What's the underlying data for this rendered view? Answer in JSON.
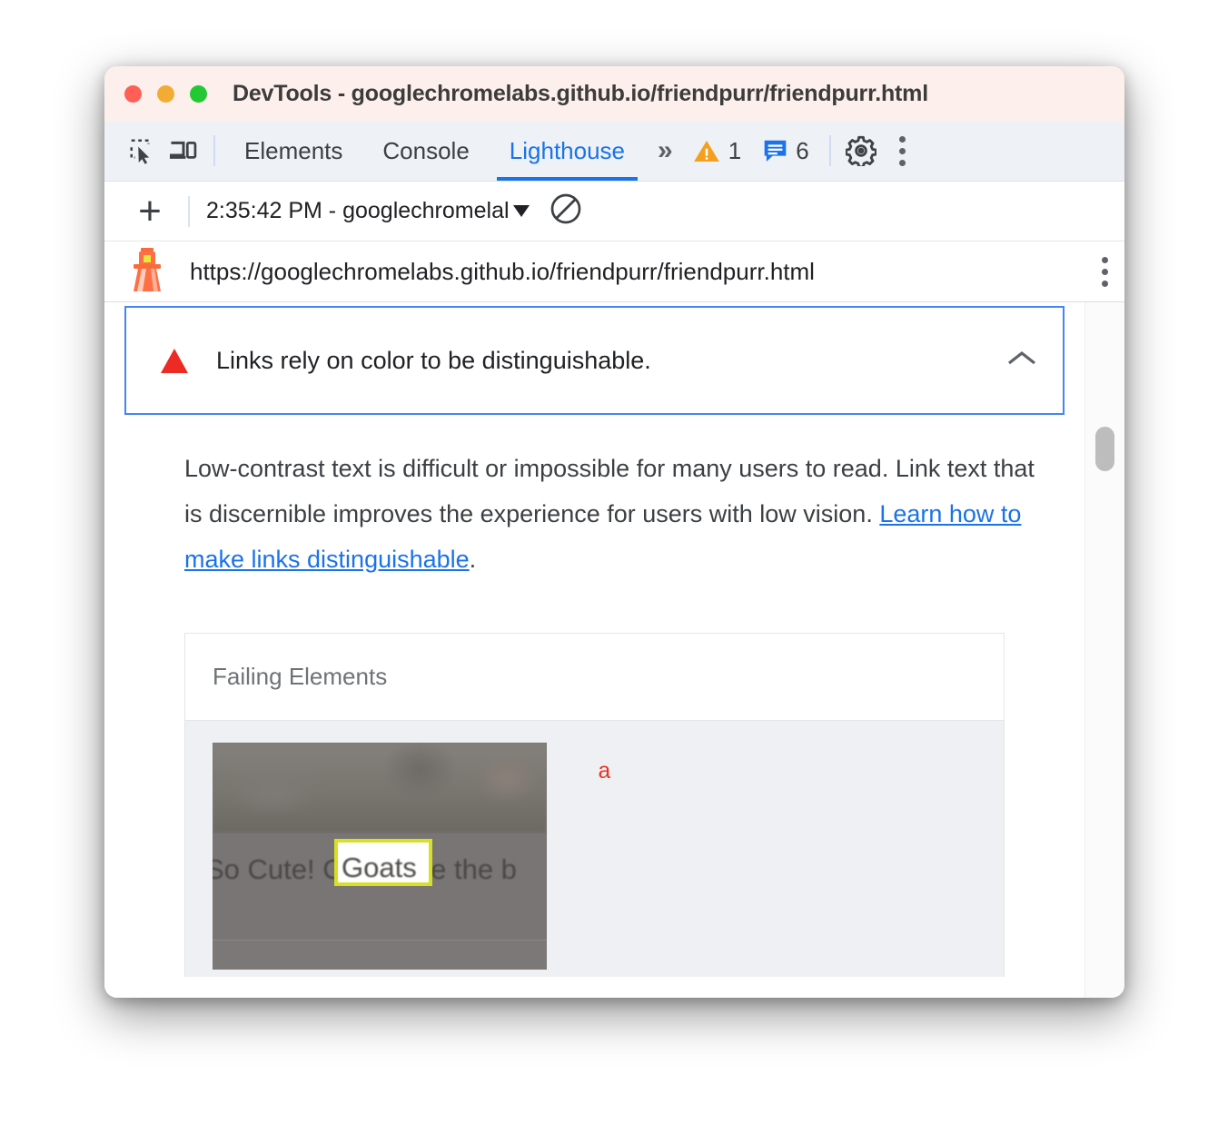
{
  "window": {
    "title": "DevTools - googlechromelabs.github.io/friendpurr/friendpurr.html",
    "traffic_lights": [
      "close",
      "minimize",
      "maximize"
    ]
  },
  "tabbar": {
    "inspect_icon": "inspect-element-icon",
    "device_icon": "device-toolbar-icon",
    "tabs": [
      {
        "label": "Elements",
        "active": false
      },
      {
        "label": "Console",
        "active": false
      },
      {
        "label": "Lighthouse",
        "active": true
      }
    ],
    "more_tabs": "»",
    "warning_count": "1",
    "message_count": "6",
    "settings_icon": "gear-icon",
    "menu_icon": "kebab-menu-icon",
    "accent_color": "#1a73e8"
  },
  "runbar": {
    "add_label": "+",
    "run_selected": "2:35:42 PM - googlechromelal",
    "dropdown_icon": "chevron-down-icon",
    "clear_icon": "no-entry-icon"
  },
  "urlbar": {
    "lighthouse_icon": "lighthouse-icon",
    "url": "https://googlechromelabs.github.io/friendpurr/friendpurr.html",
    "menu_icon": "kebab-menu-icon"
  },
  "audit": {
    "severity_icon": "red-triangle-icon",
    "title": "Links rely on color to be distinguishable.",
    "collapse_icon": "chevron-up-icon",
    "description_before": "Low-contrast text is difficult or impossible for many users to read. Link text that is discernible improves the experience for users with low vision. ",
    "description_link": "Learn how to make links distinguishable",
    "description_after": ".",
    "table": {
      "header": "Failing Elements",
      "rows": [
        {
          "thumbnail_text": "So Cute! Goats are the b",
          "highlighted_text": "Goats",
          "selector": "a"
        }
      ]
    },
    "border_color": "#4285f4",
    "severity_color": "#ec2b24",
    "selector_color": "#ee3124",
    "highlight_color": "#d7e023"
  },
  "scrollbar": {
    "thumb": "vertical-scroll-thumb"
  }
}
